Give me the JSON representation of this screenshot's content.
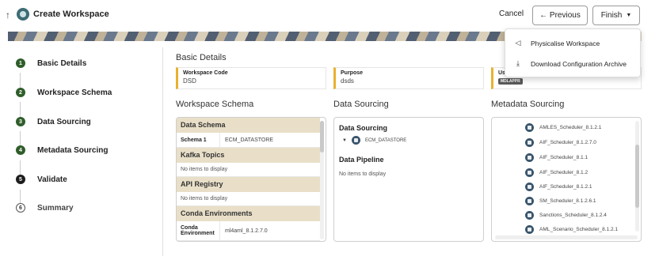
{
  "header": {
    "title": "Create Workspace",
    "cancel_label": "Cancel",
    "previous_label": "← Previous",
    "finish_label": "Finish",
    "accent_color": "#3d6c75"
  },
  "menu": {
    "items": [
      {
        "icon": "send-icon",
        "label": "Physicalise Workspace"
      },
      {
        "icon": "download-icon",
        "label": "Download Configuration Archive"
      }
    ]
  },
  "steps": [
    {
      "number": "1",
      "label": "Basic Details",
      "state": "complete"
    },
    {
      "number": "2",
      "label": "Workspace Schema",
      "state": "complete"
    },
    {
      "number": "3",
      "label": "Data Sourcing",
      "state": "complete"
    },
    {
      "number": "4",
      "label": "Metadata Sourcing",
      "state": "complete"
    },
    {
      "number": "5",
      "label": "Validate",
      "state": "current"
    },
    {
      "number": "6",
      "label": "Summary",
      "state": "pending"
    }
  ],
  "basic_details": {
    "title": "Basic Details",
    "fields": [
      {
        "label": "Workspace Code",
        "value": "DSD"
      },
      {
        "label": "Purpose",
        "value": "dsds"
      },
      {
        "label": "Us",
        "value": "MDLAPPR"
      }
    ]
  },
  "workspace_schema": {
    "title": "Workspace Schema",
    "data_schema": {
      "heading": "Data Schema",
      "row_label": "Schema 1",
      "row_value": "ECM_DATASTORE"
    },
    "kafka": {
      "heading": "Kafka Topics",
      "empty": "No items to display"
    },
    "api": {
      "heading": "API Registry",
      "empty": "No items to display"
    },
    "conda": {
      "heading": "Conda Environments",
      "row_label": "Conda Environment",
      "row_value": "ml4aml_8.1.2.7.0"
    }
  },
  "data_sourcing": {
    "title": "Data Sourcing",
    "panel_heading": "Data Sourcing",
    "item": "ECM_DATASTORE",
    "pipeline_heading": "Data Pipeline",
    "pipeline_empty": "No items to display"
  },
  "metadata_sourcing": {
    "title": "Metadata Sourcing",
    "items": [
      "AMLES_Scheduler_8.1.2.1",
      "AIF_Scheduler_8.1.2.7.0",
      "AIF_Scheduler_8.1.1",
      "AIF_Scheduler_8.1.2",
      "AIF_Scheduler_8.1.2.1",
      "SM_Scheduler_8.1.2.6.1",
      "Sanctions_Scheduler_8.1.2.4",
      "AML_Scenario_Scheduler_8.1.2.1"
    ]
  }
}
